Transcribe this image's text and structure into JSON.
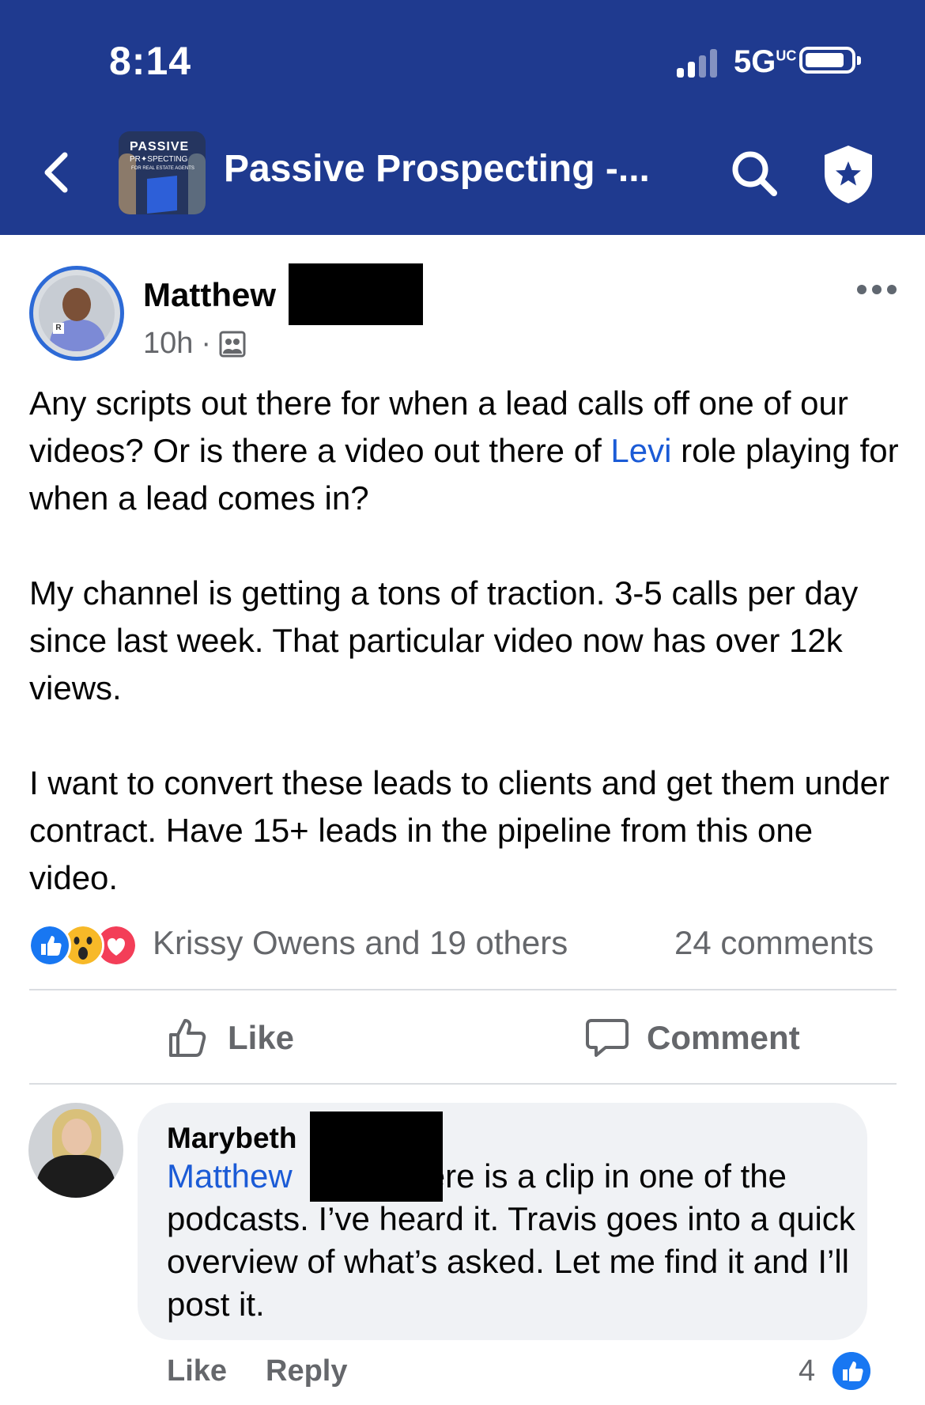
{
  "status_bar": {
    "time": "8:14",
    "network": "5G",
    "network_suffix": "UC"
  },
  "header": {
    "group_title": "Passive Prospecting -...",
    "thumb_line1": "PASSIVE",
    "thumb_line2": "PR✦SPECTING",
    "thumb_line3": "FOR REAL ESTATE AGENTS"
  },
  "post": {
    "author": "Matthew",
    "time": "10h",
    "separator": "·",
    "paragraphs": [
      {
        "before": "Any scripts out there for when a lead calls off one of our videos? Or is there a video out there of ",
        "mention": "Levi",
        "after": " role playing for when a lead comes in?"
      },
      {
        "text": "My channel is getting a tons of traction. 3-5 calls per day since last week. That particular video now has over 12k views."
      },
      {
        "text": "I want to convert these leads to clients and get them under contract. Have 15+ leads in the pipeline from this one video."
      }
    ],
    "reactions": [
      "like",
      "wow",
      "love"
    ],
    "reaction_summary": "Krissy Owens and 19 others",
    "comment_count": "24 comments",
    "like_label": "Like",
    "comment_label": "Comment"
  },
  "comment": {
    "author": "Marybeth",
    "mention": "Matthew",
    "text_line1": "ere is a clip in one of",
    "text_rest": "the podcasts. I’ve heard it. Travis goes into a quick overview of what’s asked. Let me find it and I’ll post it.",
    "like_label": "Like",
    "reply_label": "Reply",
    "like_count": "4"
  },
  "colors": {
    "header_bg": "#1f3a8f",
    "link": "#1b5bd6",
    "like_blue": "#1877f2",
    "love_red": "#f33e58",
    "wow_yellow": "#f7b928"
  }
}
